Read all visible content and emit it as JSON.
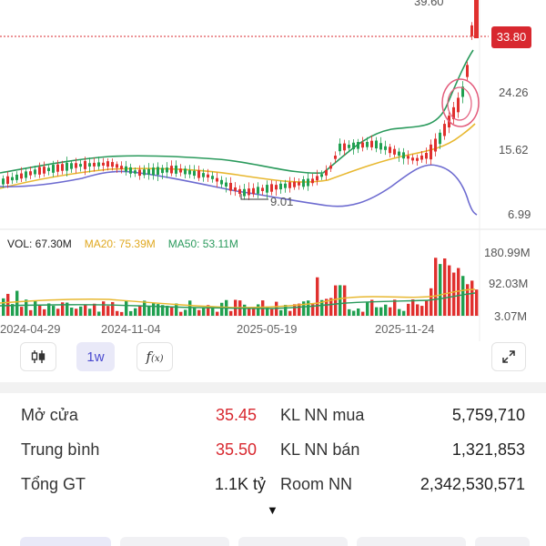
{
  "chart": {
    "top_partial_label": "39.60",
    "current_price": "33.80",
    "price_ticks": [
      "24.26",
      "15.62",
      "6.99"
    ],
    "low_marker_label": "9.01",
    "volume_ticks": [
      "180.99M",
      "92.03M",
      "3.07M"
    ],
    "date_labels": [
      "2024-04-29",
      "2024-11-04",
      "2025-05-19",
      "2025-11-24"
    ],
    "colors": {
      "up": "#20a050",
      "down": "#e0302e",
      "ma_yellow": "#e8b830",
      "bb_upper": "#2a9a5c",
      "bb_lower": "#6d6bd0",
      "ref_line": "#d8282f"
    }
  },
  "volume_legend": {
    "vol": "VOL: 67.30M",
    "ma20": "MA20: 75.39M",
    "ma50": "MA50: 53.11M",
    "vol_color": "#222222",
    "ma20_color": "#e8b830",
    "ma50_color": "#2a9a5c"
  },
  "toolbar": {
    "candle_icon": "candlestick-icon",
    "interval_label": "1w",
    "function_icon": "function-icon",
    "expand_icon": "expand-icon"
  },
  "stats": {
    "rows": [
      {
        "left_label": "Mở cửa",
        "left_value": "35.45",
        "right_label": "KL NN mua",
        "right_value": "5,759,710"
      },
      {
        "left_label": "Trung bình",
        "left_value": "35.50",
        "right_label": "KL NN bán",
        "right_value": "1,321,853"
      },
      {
        "left_label": "Tổng GT",
        "left_value": "1.1K tỷ",
        "right_label": "Room NN",
        "right_value": "2,342,530,571"
      }
    ],
    "expand_symbol": "▼"
  }
}
